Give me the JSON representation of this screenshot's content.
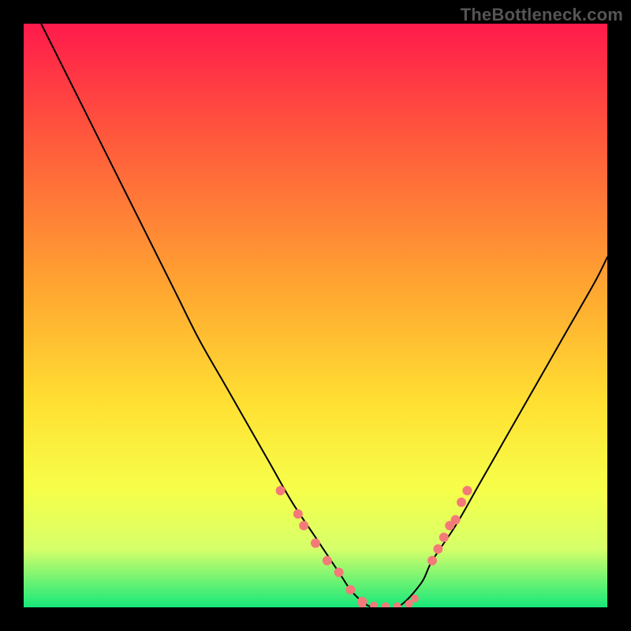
{
  "watermark": "TheBottleneck.com",
  "chart_data": {
    "type": "line",
    "title": "",
    "xlabel": "",
    "ylabel": "",
    "xlim": [
      0,
      100
    ],
    "ylim": [
      0,
      100
    ],
    "grid": false,
    "legend": "none",
    "background_gradient": {
      "type": "vertical-linear",
      "stops": [
        {
          "pct": 0,
          "color": "#ff1a4b"
        },
        {
          "pct": 20,
          "color": "#ff5a3c"
        },
        {
          "pct": 45,
          "color": "#ffa531"
        },
        {
          "pct": 65,
          "color": "#ffe032"
        },
        {
          "pct": 80,
          "color": "#f6ff4a"
        },
        {
          "pct": 90,
          "color": "#d6ff6a"
        },
        {
          "pct": 100,
          "color": "#17e87a"
        }
      ]
    },
    "series": [
      {
        "name": "bottleneck-curve",
        "stroke": "#000000",
        "stroke_width": 2,
        "x": [
          3,
          6,
          10,
          14,
          18,
          22,
          26,
          30,
          34,
          38,
          42,
          46,
          50,
          54,
          56,
          58,
          60,
          64,
          68,
          70,
          74,
          78,
          82,
          86,
          90,
          94,
          98,
          100
        ],
        "y": [
          100,
          94,
          86,
          78,
          70,
          62,
          54,
          46,
          39,
          32,
          25,
          18,
          12,
          6,
          3,
          1,
          0,
          0,
          4,
          8,
          14,
          21,
          28,
          35,
          42,
          49,
          56,
          60
        ]
      }
    ],
    "markers": [
      {
        "name": "marker-cluster-left",
        "color": "#f47a7a",
        "radius": 6,
        "points_pct": [
          [
            44,
            20
          ],
          [
            47,
            16
          ],
          [
            48,
            14
          ],
          [
            50,
            11
          ],
          [
            52,
            8
          ],
          [
            54,
            6
          ],
          [
            56,
            3
          ],
          [
            58,
            1
          ]
        ]
      },
      {
        "name": "marker-cluster-bottom",
        "color": "#f47a7a",
        "radius": 5,
        "points_pct": [
          [
            58,
            0.5
          ],
          [
            60,
            0.3
          ],
          [
            62,
            0.2
          ],
          [
            64,
            0.2
          ],
          [
            66,
            0.6
          ],
          [
            67,
            1.5
          ]
        ]
      },
      {
        "name": "marker-cluster-right",
        "color": "#f47a7a",
        "radius": 6,
        "points_pct": [
          [
            70,
            8
          ],
          [
            71,
            10
          ],
          [
            72,
            12
          ],
          [
            73,
            14
          ],
          [
            74,
            15
          ],
          [
            75,
            18
          ],
          [
            76,
            20
          ]
        ]
      }
    ]
  }
}
